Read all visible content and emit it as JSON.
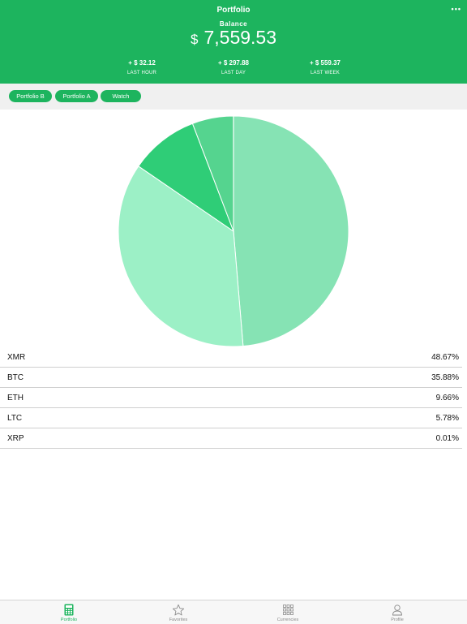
{
  "header": {
    "title": "Portfolio",
    "more": "•••",
    "balance_label": "Balance",
    "currency_symbol": "$",
    "balance": "7,559.53",
    "stats": [
      {
        "value": "+ $ 32.12",
        "label": "LAST HOUR"
      },
      {
        "value": "+ $ 297.88",
        "label": "LAST DAY"
      },
      {
        "value": "+ $ 559.37",
        "label": "LAST WEEK"
      }
    ]
  },
  "tabs": [
    {
      "label": "Portfolio B"
    },
    {
      "label": "Portfolio A"
    },
    {
      "label": "Watch"
    }
  ],
  "chart_data": {
    "type": "pie",
    "categories": [
      "XMR",
      "BTC",
      "ETH",
      "LTC",
      "XRP"
    ],
    "values": [
      48.67,
      35.88,
      9.66,
      5.78,
      0.01
    ],
    "colors": [
      "#86e3b4",
      "#9cf0c6",
      "#2fcd77",
      "#55d48f",
      "#7ee6b0"
    ]
  },
  "holdings": [
    {
      "symbol": "XMR",
      "percent": "48.67%"
    },
    {
      "symbol": "BTC",
      "percent": "35.88%"
    },
    {
      "symbol": "ETH",
      "percent": "9.66%"
    },
    {
      "symbol": "LTC",
      "percent": "5.78%"
    },
    {
      "symbol": "XRP",
      "percent": "0.01%"
    }
  ],
  "nav": [
    {
      "label": "Portfolio",
      "icon": "calculator-icon",
      "active": true
    },
    {
      "label": "Favorites",
      "icon": "star-icon",
      "active": false
    },
    {
      "label": "Currencies",
      "icon": "grid-icon",
      "active": false
    },
    {
      "label": "Profile",
      "icon": "person-icon",
      "active": false
    }
  ],
  "colors": {
    "accent": "#1db45e",
    "tabbar_bg": "#f0f0f0",
    "nav_inactive": "#8a8a8a"
  }
}
